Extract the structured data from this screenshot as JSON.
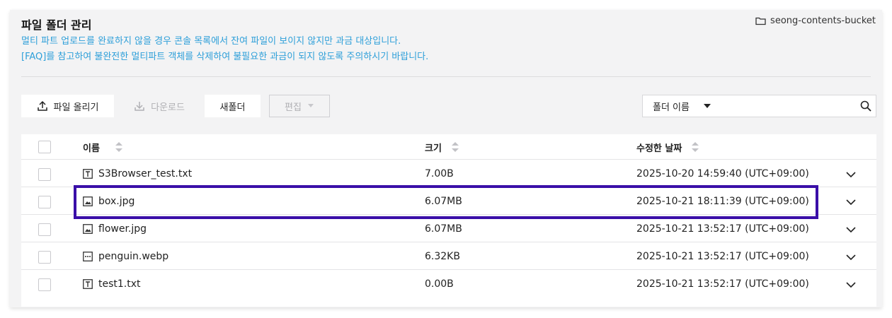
{
  "header": {
    "title": "파일 폴더 관리",
    "notice_line1": "멀티 파트 업로드를 완료하지 않을 경우 콘솔 목록에서 잔여 파일이 보이지 않지만 과금 대상입니다.",
    "notice_line2": "[FAQ]를 참고하여 불완전한 멀티파트 객체를 삭제하여 불필요한 과금이 되지 않도록 주의하시기 바랍니다.",
    "bucket_name": "seong-contents-bucket"
  },
  "toolbar": {
    "upload_label": "파일 올리기",
    "download_label": "다운로드",
    "new_folder_label": "새폴더",
    "edit_label": "편집"
  },
  "filter": {
    "selected": "폴더 이름",
    "search_value": ""
  },
  "table": {
    "columns": {
      "name": "이름",
      "size": "크기",
      "modified": "수정한 날짜"
    },
    "rows": [
      {
        "icon": "text-file-icon",
        "name": "S3Browser_test.txt",
        "size": "7.00B",
        "modified": "2025-10-20 14:59:40 (UTC+09:00)"
      },
      {
        "icon": "image-file-icon",
        "name": "box.jpg",
        "size": "6.07MB",
        "modified": "2025-10-21 18:11:39 (UTC+09:00)"
      },
      {
        "icon": "image-file-icon",
        "name": "flower.jpg",
        "size": "6.07MB",
        "modified": "2025-10-21 13:52:17 (UTC+09:00)"
      },
      {
        "icon": "generic-file-icon",
        "name": "penguin.webp",
        "size": "6.32KB",
        "modified": "2025-10-21 13:52:17 (UTC+09:00)"
      },
      {
        "icon": "text-file-icon",
        "name": "test1.txt",
        "size": "0.00B",
        "modified": "2025-10-21 13:52:17 (UTC+09:00)"
      }
    ]
  },
  "colors": {
    "notice": "#2d9fd9",
    "highlight": "#3a0fa8",
    "panel": "#f3f3f4"
  }
}
